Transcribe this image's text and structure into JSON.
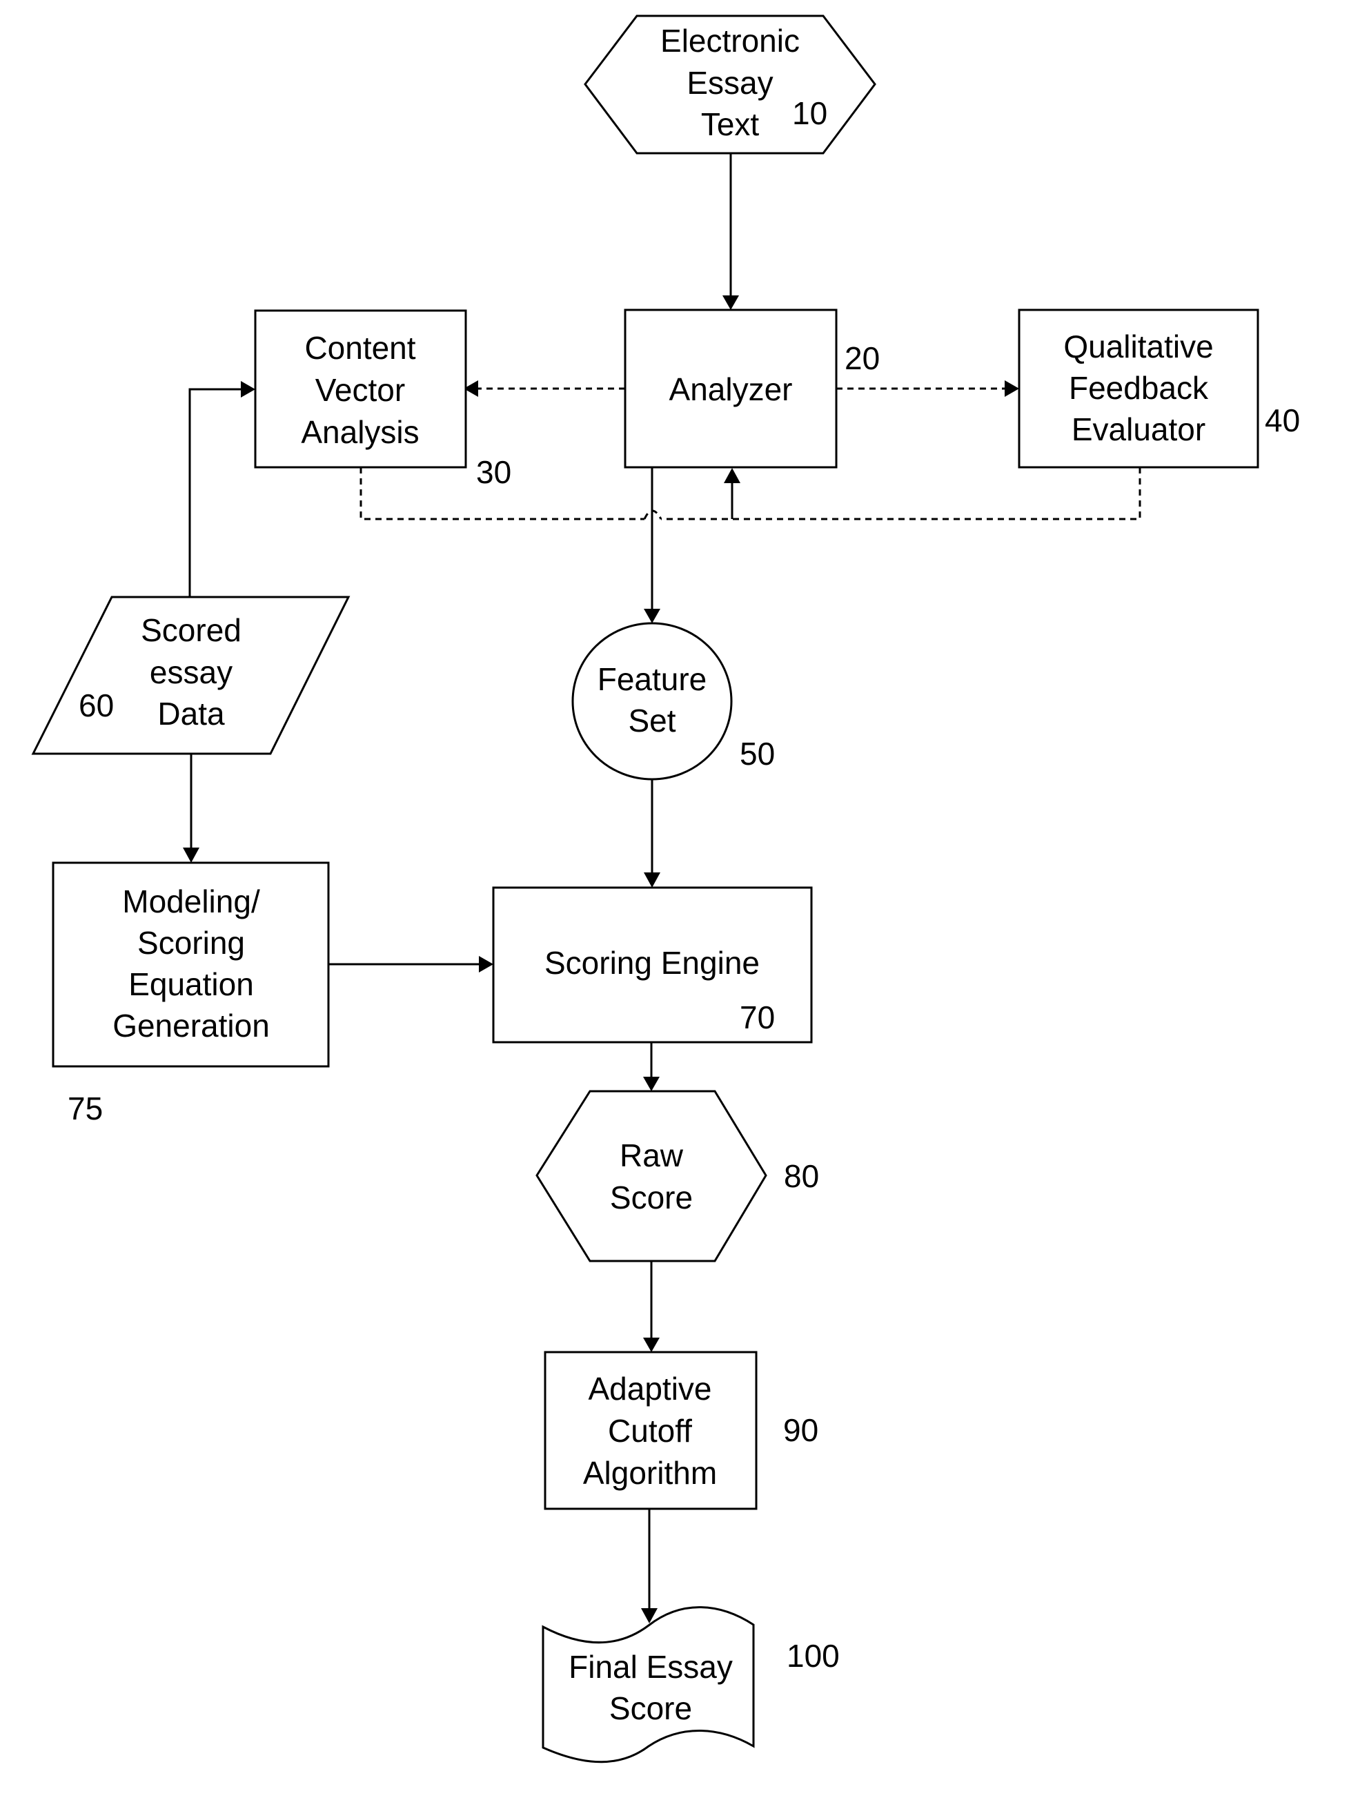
{
  "diagram": {
    "nodes": {
      "essay_text": {
        "id": "10",
        "shape": "hexagon",
        "lines": [
          "Electronic",
          "Essay",
          "Text"
        ]
      },
      "analyzer": {
        "id": "20",
        "shape": "rectangle",
        "lines": [
          "Analyzer"
        ]
      },
      "content_vector": {
        "id": "30",
        "shape": "rectangle",
        "lines": [
          "Content",
          "Vector",
          "Analysis"
        ]
      },
      "qualitative_feedback": {
        "id": "40",
        "shape": "rectangle",
        "lines": [
          "Qualitative",
          "Feedback",
          "Evaluator"
        ]
      },
      "feature_set": {
        "id": "50",
        "shape": "circle",
        "lines": [
          "Feature",
          "Set"
        ]
      },
      "scored_essay_data": {
        "id": "60",
        "shape": "parallelogram",
        "lines": [
          "Scored",
          "essay",
          "Data"
        ]
      },
      "scoring_engine": {
        "id": "70",
        "shape": "rectangle",
        "lines": [
          "Scoring Engine"
        ]
      },
      "modeling": {
        "id": "75",
        "shape": "rectangle",
        "lines": [
          "Modeling/",
          "Scoring",
          "Equation",
          "Generation"
        ]
      },
      "raw_score": {
        "id": "80",
        "shape": "hexagon",
        "lines": [
          "Raw",
          "Score"
        ]
      },
      "adaptive_cutoff": {
        "id": "90",
        "shape": "rectangle",
        "lines": [
          "Adaptive",
          "Cutoff",
          "Algorithm"
        ]
      },
      "final_score": {
        "id": "100",
        "shape": "document",
        "lines": [
          "Final Essay",
          "Score"
        ]
      }
    },
    "edges": [
      {
        "from": "essay_text",
        "to": "analyzer",
        "style": "solid"
      },
      {
        "from": "analyzer",
        "to": "content_vector",
        "style": "dashed"
      },
      {
        "from": "analyzer",
        "to": "qualitative_feedback",
        "style": "dashed"
      },
      {
        "from": "content_vector",
        "to": "analyzer",
        "style": "dashed"
      },
      {
        "from": "qualitative_feedback",
        "to": "analyzer",
        "style": "dashed"
      },
      {
        "from": "analyzer",
        "to": "feature_set",
        "style": "solid"
      },
      {
        "from": "scored_essay_data",
        "to": "content_vector",
        "style": "solid"
      },
      {
        "from": "scored_essay_data",
        "to": "modeling",
        "style": "solid"
      },
      {
        "from": "feature_set",
        "to": "scoring_engine",
        "style": "solid"
      },
      {
        "from": "modeling",
        "to": "scoring_engine",
        "style": "solid"
      },
      {
        "from": "scoring_engine",
        "to": "raw_score",
        "style": "solid"
      },
      {
        "from": "raw_score",
        "to": "adaptive_cutoff",
        "style": "solid"
      },
      {
        "from": "adaptive_cutoff",
        "to": "final_score",
        "style": "solid"
      }
    ]
  }
}
